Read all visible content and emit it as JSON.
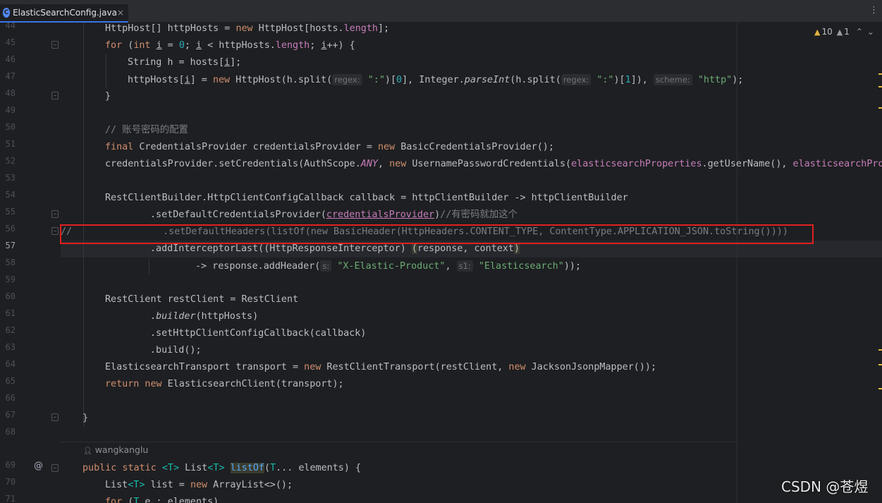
{
  "tab": {
    "icon": "C",
    "filename": "ElasticSearchConfig.java",
    "close": "×"
  },
  "menu": "⋮",
  "inspections": {
    "warnings": "10",
    "weak": "1",
    "up": "⌃",
    "down": "⌄"
  },
  "author": "wangkanglu",
  "watermark": "CSDN @苍煜",
  "line_numbers": [
    "44",
    "45",
    "46",
    "47",
    "48",
    "49",
    "50",
    "51",
    "52",
    "53",
    "54",
    "55",
    "56",
    "57",
    "58",
    "59",
    "60",
    "61",
    "62",
    "63",
    "64",
    "65",
    "66",
    "67",
    "68",
    "69",
    "70",
    "71"
  ],
  "code": {
    "l44a": "HttpHost[] httpHosts = ",
    "l44kw": "new",
    " l44b": " HttpHost[hosts.",
    "l44f": "length",
    "l44c": "];",
    "l45kw": "for",
    " l45a": " (",
    "l45int": "int",
    " l45b": " ",
    "l45i1": "i",
    " l45c": " = ",
    "l45n0": "0",
    " l45d": "; ",
    "l45i2": "i",
    " l45e": " < httpHosts.",
    "l45f": "length",
    " l45g": "; ",
    "l45i3": "i",
    " l45h": "++) {",
    "l46a": "String h = hosts[",
    "l46i": "i",
    " l46b": "];",
    "l47a": "httpHosts[",
    "l47i": "i",
    " l47b": "] = ",
    "l47kw": "new",
    " l47c": " HttpHost(h.split(",
    "l47p1": "regex:",
    " l47s1": "\":\"",
    " l47d": ")[",
    "l47n0": "0",
    " l47e": "], Integer.",
    "l47m": "parseInt",
    " l47f": "(h.split(",
    "l47p2": "regex:",
    " l47s2": "\":\"",
    " l47g": ")[",
    "l47n1": "1",
    " l47h": "]), ",
    "l47p3": "scheme:",
    " l47s3": "\"http\"",
    " l47j": ");",
    "l48": "}",
    "l50": "// 账号密码的配置",
    "l51kw": "final",
    " l51a": " CredentialsProvider credentialsProvider = ",
    "l51kw2": "new",
    " l51b": " BasicCredentialsProvider();",
    "l52a": "credentialsProvider.setCredentials(AuthScope.",
    "l52any": "ANY",
    " l52b": ", ",
    "l52kw": "new",
    " l52c": " UsernamePasswordCredentials(",
    "l52f1": "elasticsearchProperties",
    " l52d": ".getUserName(), ",
    "l52f2": "elasticsearchProp",
    "l54": "RestClientBuilder.HttpClientConfigCallback callback = httpClientBuilder -> httpClientBuilder",
    "l55a": ".setDefaultCredentialsProvider(",
    "l55u": "credentialsProvider",
    " l55b": ")",
    "l55c": "//有密码就加这个",
    "l56": "//                .setDefaultHeaders(listOf(new BasicHeader(HttpHeaders.CONTENT_TYPE, ContentType.APPLICATION_JSON.toString())))",
    "l57a": ".addInterceptorLast((HttpResponseInterceptor) ",
    "l57b": "(",
    "l57c": "response, context",
    "l57d": ")",
    "l58a": "-> response.addHeader(",
    "l58p1": "s:",
    " l58s1": "\"X-Elastic-Product\"",
    " l58b": ", ",
    "l58p2": "s1:",
    " l58s2": "\"Elasticsearch\"",
    " l58c": "));",
    "l60": "RestClient restClient = RestClient",
    "l61a": ".",
    "l61m": "builder",
    " l61b": "(httpHosts)",
    "l62": ".setHttpClientConfigCallback(callback)",
    "l63": ".build();",
    "l64a": "ElasticsearchTransport transport = ",
    "l64kw": "new",
    " l64b": " RestClientTransport(restClient, ",
    "l64kw2": "new",
    " l64c": " JacksonJsonpMapper());",
    "l65kw": "return",
    " l65kw2": " new",
    " l65a": " ElasticsearchClient(transport);",
    "l67": "}",
    "l69kw": "public static",
    " l69a": " ",
    "l69t1": "<T>",
    " l69b": " List",
    "l69t2": "<T>",
    " l69c": " ",
    "l69m": "listOf",
    " l69d": "(",
    "l69t3": "T",
    " l69e": "... elements) {",
    "l70a": "List",
    "l70t": "<T>",
    " l70b": " list = ",
    "l70kw": "new",
    " l70c": " ArrayList<>();",
    "l71kw": "for",
    " l71a": " (",
    "l71t": "T",
    " l71b": " e : elements)"
  }
}
